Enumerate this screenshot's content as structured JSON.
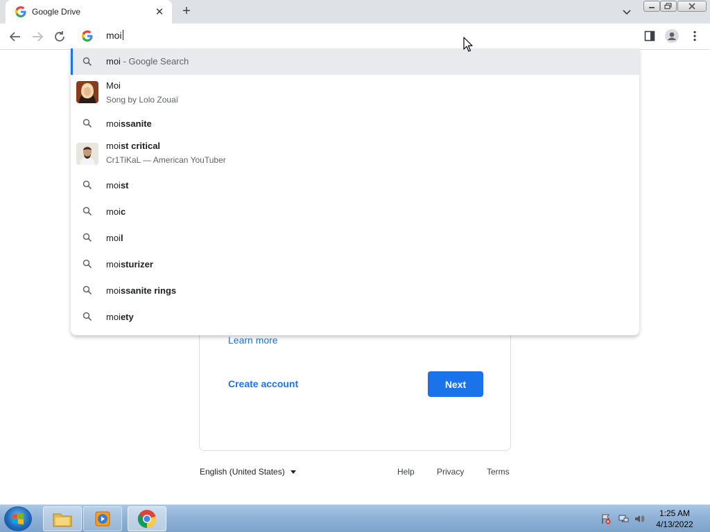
{
  "tab": {
    "title": "Google Drive"
  },
  "omnibox": {
    "input": "moi"
  },
  "suggestions": [
    {
      "type": "search",
      "prefix": "moi",
      "suffix": "",
      "sep": " - ",
      "hint": "Google Search",
      "selected": true
    },
    {
      "type": "entity",
      "title": "Moi",
      "subtitle": "Song by Lolo Zouaï",
      "thumb": "lolo-zouai"
    },
    {
      "type": "search",
      "prefix": "moi",
      "suffix": "ssanite"
    },
    {
      "type": "entity",
      "prefix": "moi",
      "suffix": "st critical",
      "subtitle": "Cr1TiKaL — American YouTuber",
      "thumb": "critikal"
    },
    {
      "type": "search",
      "prefix": "moi",
      "suffix": "st"
    },
    {
      "type": "search",
      "prefix": "moi",
      "suffix": "c"
    },
    {
      "type": "search",
      "prefix": "moi",
      "suffix": "l"
    },
    {
      "type": "search",
      "prefix": "moi",
      "suffix": "sturizer"
    },
    {
      "type": "search",
      "prefix": "moi",
      "suffix": "ssanite rings"
    },
    {
      "type": "search",
      "prefix": "moi",
      "suffix": "ety"
    }
  ],
  "card": {
    "learn_more": "Learn more",
    "create_account": "Create account",
    "next": "Next"
  },
  "footer": {
    "language": "English (United States)",
    "help": "Help",
    "privacy": "Privacy",
    "terms": "Terms"
  },
  "taskbar": {
    "apps": [
      "windows-explorer",
      "media-player",
      "google-chrome"
    ],
    "time": "1:25 AM",
    "date": "4/13/2022"
  },
  "colors": {
    "accent": "#1a73e8",
    "tabstrip": "#dee1e6",
    "selected_row": "#e8eaed"
  }
}
